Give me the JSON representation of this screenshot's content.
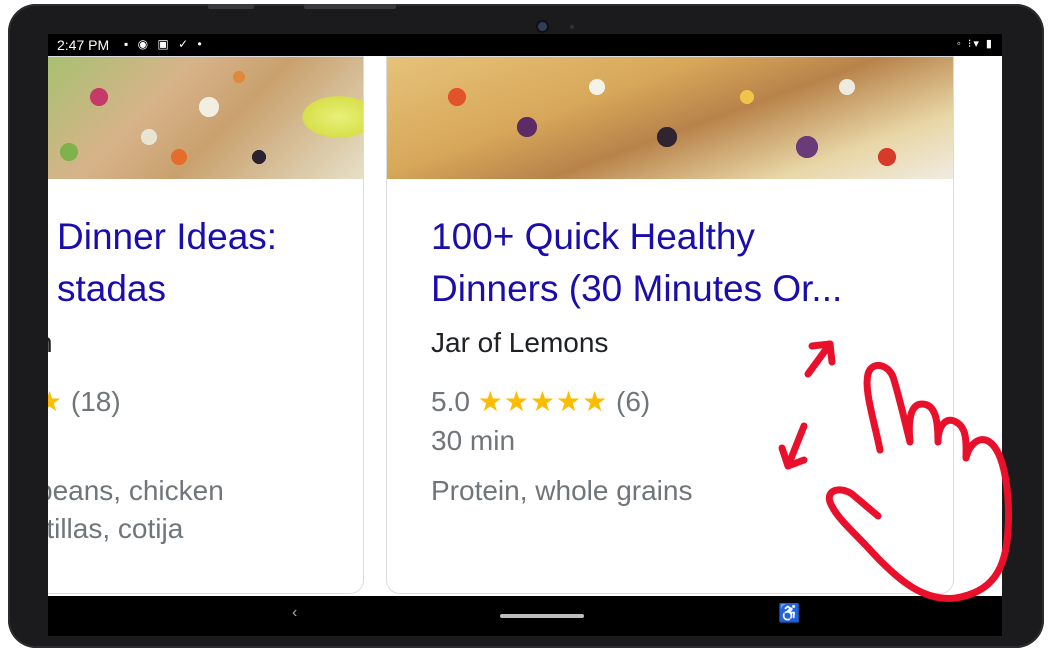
{
  "status_bar": {
    "time": "2:47 PM",
    "left_icons": "▪ ◉ ▣ ✓ •",
    "right_icons": "◦ ⁝▾ ▮"
  },
  "cards": [
    {
      "title_line1": "Dinner Ideas:",
      "title_line2": "stadas",
      "source": "n",
      "stars": "★",
      "rating_count": "(18)",
      "ingredients_line1": "beans, chicken",
      "ingredients_line2": "rtillas, cotija"
    },
    {
      "title_line1": "100+ Quick Healthy",
      "title_line2": "Dinners (30 Minutes Or...",
      "source": "Jar of Lemons",
      "rating": "5.0",
      "stars": "★★★★★",
      "rating_count": "(6)",
      "time": "30 min",
      "tags": "Protein, whole grains"
    }
  ],
  "nav_bar": {
    "back": "‹",
    "accessibility": "♿"
  },
  "gesture_color": "#e8102a"
}
